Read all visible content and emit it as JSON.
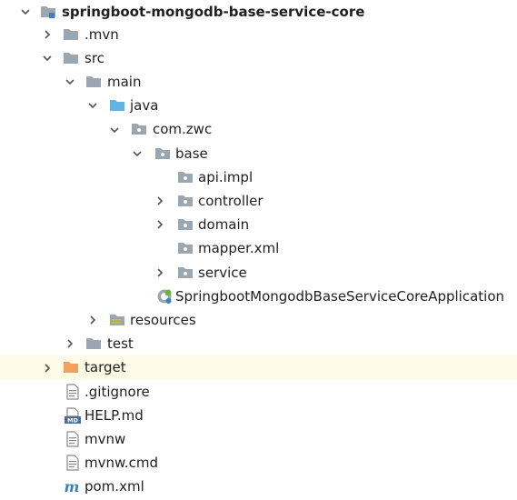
{
  "project": {
    "name": "springboot-mongodb-base-service-core",
    "icon": "module-folder-icon"
  },
  "tree": [
    {
      "label": ".mvn",
      "icon": "folder-icon",
      "expander": "collapsed"
    },
    {
      "label": "src",
      "icon": "folder-icon",
      "expander": "expanded"
    },
    {
      "label": "main",
      "icon": "folder-icon",
      "expander": "expanded"
    },
    {
      "label": "java",
      "icon": "source-root-folder-icon",
      "expander": "expanded"
    },
    {
      "label": "com.zwc",
      "icon": "package-icon",
      "expander": "expanded"
    },
    {
      "label": "base",
      "icon": "package-icon",
      "expander": "expanded"
    },
    {
      "label": "api.impl",
      "icon": "package-icon",
      "expander": "none"
    },
    {
      "label": "controller",
      "icon": "package-icon",
      "expander": "collapsed"
    },
    {
      "label": "domain",
      "icon": "package-icon",
      "expander": "collapsed"
    },
    {
      "label": "mapper.xml",
      "icon": "package-icon",
      "expander": "none"
    },
    {
      "label": "service",
      "icon": "package-icon",
      "expander": "collapsed"
    },
    {
      "label": "SpringbootMongodbBaseServiceCoreApplication",
      "icon": "spring-boot-class-icon",
      "expander": "none"
    },
    {
      "label": "resources",
      "icon": "resources-folder-icon",
      "expander": "collapsed"
    },
    {
      "label": "test",
      "icon": "folder-icon",
      "expander": "collapsed"
    },
    {
      "label": "target",
      "icon": "excluded-folder-icon",
      "expander": "collapsed"
    },
    {
      "label": ".gitignore",
      "icon": "text-file-icon",
      "expander": "none"
    },
    {
      "label": "HELP.md",
      "icon": "markdown-file-icon",
      "expander": "none"
    },
    {
      "label": "mvnw",
      "icon": "text-file-icon",
      "expander": "none"
    },
    {
      "label": "mvnw.cmd",
      "icon": "text-file-icon",
      "expander": "none"
    },
    {
      "label": "pom.xml",
      "icon": "maven-file-icon",
      "expander": "none"
    }
  ],
  "selected_row": "target",
  "colors": {
    "folder": "#9aa7b0",
    "source_root": "#62b4e6",
    "excluded_folder": "#f0a15b",
    "spring": "#6db33f",
    "maven": "#3d7fc6",
    "highlight": "#fdfbe8"
  }
}
